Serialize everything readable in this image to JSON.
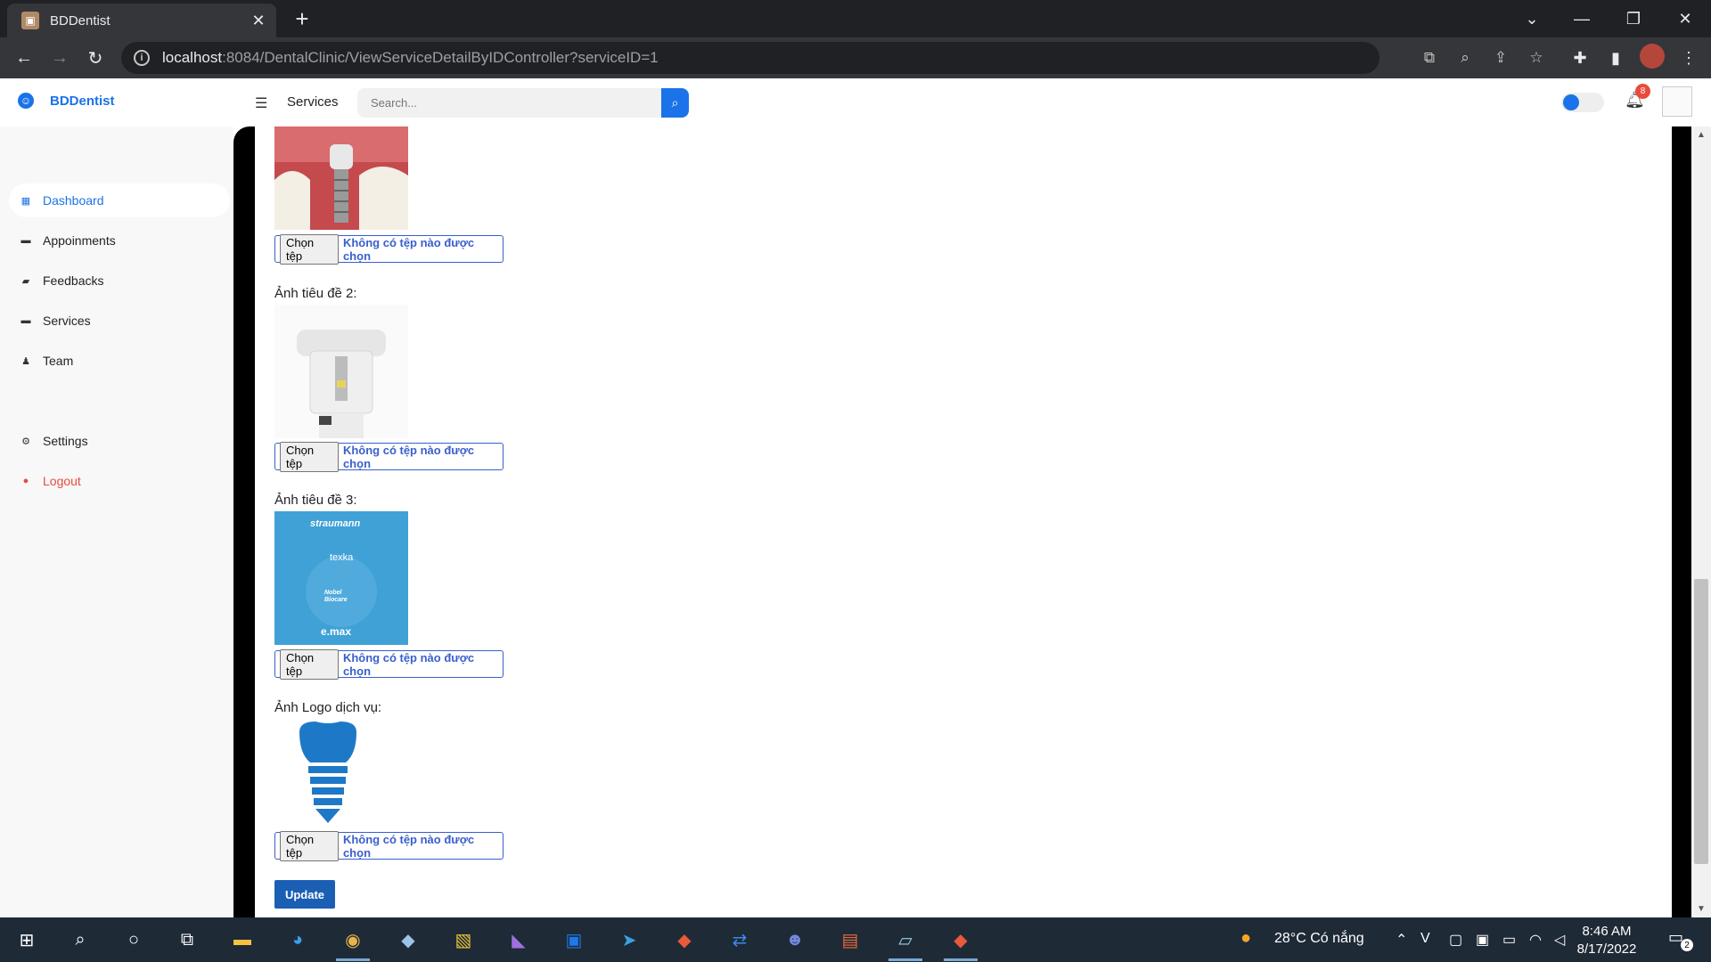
{
  "browser": {
    "tab_title": "BDDentist",
    "tab_close": "✕",
    "new_tab": "+",
    "url_host": "localhost",
    "url_path": ":8084/DentalClinic/ViewServiceDetailByIDController?serviceID=1",
    "window_controls": {
      "minimize": "—",
      "restore": "❐",
      "close": "✕",
      "dropdown": "⌄"
    }
  },
  "app": {
    "brand": "BDDentist",
    "page_label": "Services",
    "search_placeholder": "Search...",
    "notification_count": "8"
  },
  "sidebar": {
    "items": [
      {
        "label": "Dashboard",
        "icon": "grid-icon",
        "glyph": "▦",
        "active": true
      },
      {
        "label": "Appoinments",
        "icon": "calendar-icon",
        "glyph": "▬"
      },
      {
        "label": "Feedbacks",
        "icon": "chat-icon",
        "glyph": "▰"
      },
      {
        "label": "Services",
        "icon": "briefcase-icon",
        "glyph": "▬"
      },
      {
        "label": "Team",
        "icon": "users-icon",
        "glyph": "♟"
      }
    ],
    "settings": {
      "label": "Settings",
      "glyph": "⚙"
    },
    "logout": {
      "label": "Logout",
      "glyph": "●"
    }
  },
  "form": {
    "label_image2": "Ảnh tiêu đề 2:",
    "label_image3": "Ảnh tiêu đề 3:",
    "label_logo": "Ảnh Logo dịch vụ:",
    "choose_file": "Chọn tệp",
    "no_file": "Không có tệp nào được chọn",
    "image3_brands": [
      "straumann",
      "texka",
      "Nobel Biocare",
      "e.max"
    ],
    "update_button": "Update"
  },
  "taskbar": {
    "weather": "28°C  Có nắng",
    "time": "8:46 AM",
    "date": "8/17/2022",
    "notification_count": "2"
  }
}
